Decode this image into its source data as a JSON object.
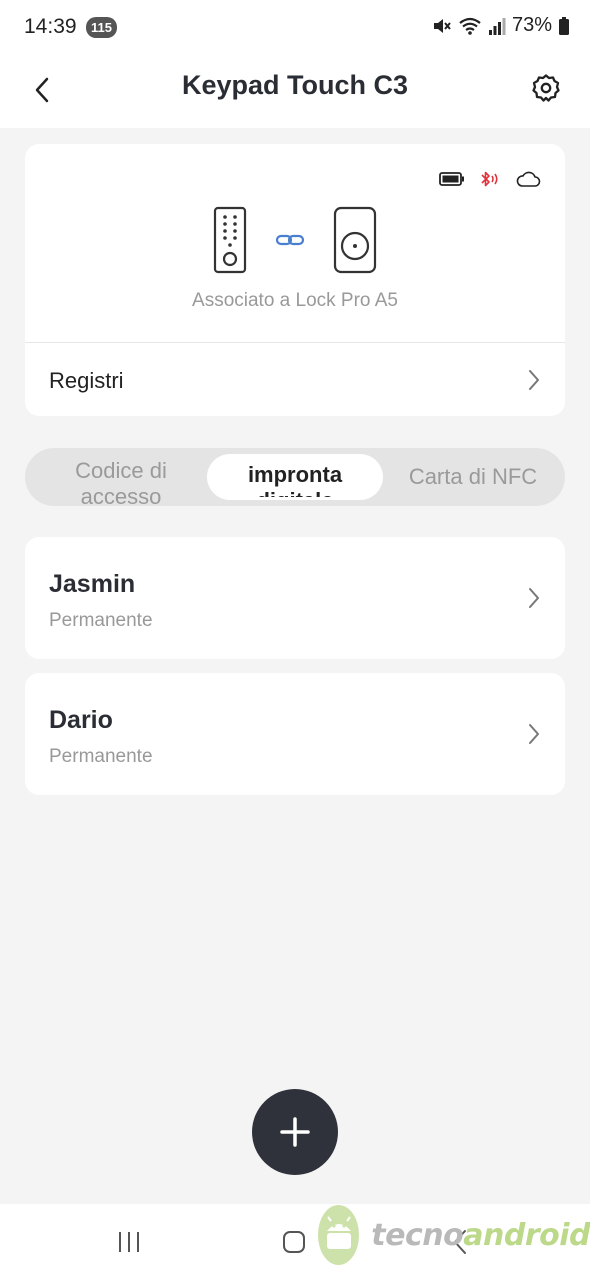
{
  "status_bar": {
    "time": "14:39",
    "notification_count": "115",
    "battery_percent": "73%"
  },
  "header": {
    "title": "Keypad Touch C3"
  },
  "device": {
    "associated_text": "Associato a Lock Pro A5",
    "status_icons": [
      "battery-icon",
      "bluetooth-icon",
      "cloud-icon"
    ],
    "registri_label": "Registri"
  },
  "tabs": [
    {
      "label": "Codice di accesso",
      "selected": false
    },
    {
      "label": "impronta digitale",
      "selected": true
    },
    {
      "label": "Carta di NFC",
      "selected": false
    }
  ],
  "users": [
    {
      "name": "Jasmin",
      "type": "Permanente"
    },
    {
      "name": "Dario",
      "type": "Permanente"
    }
  ],
  "watermark": {
    "part1": "tecno",
    "part2": "android"
  },
  "colors": {
    "accent": "#2f323b",
    "link_blue": "#4a7fd0",
    "bluetooth_red": "#e0323a",
    "background": "#f4f4f4"
  }
}
